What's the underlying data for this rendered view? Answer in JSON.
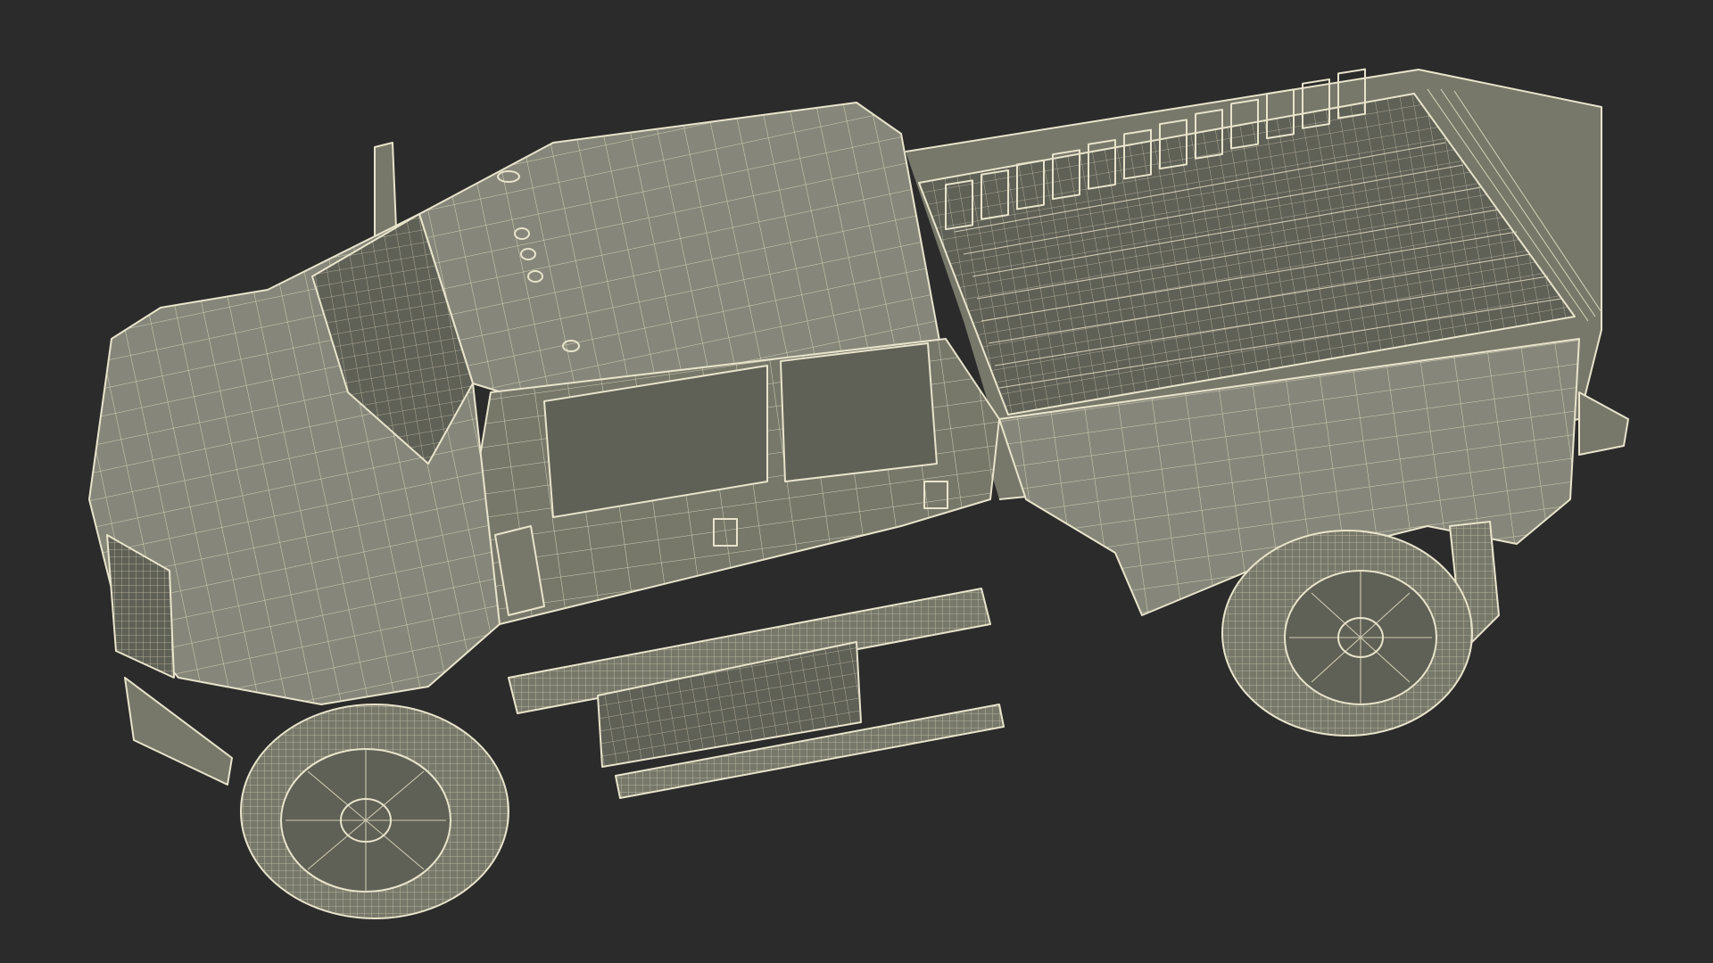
{
  "scene": {
    "subject": "pickup-truck-wireframe",
    "background_color": "#2b2b2b",
    "surface_color": "#77786a",
    "wire_color": "#e8e4cc"
  }
}
